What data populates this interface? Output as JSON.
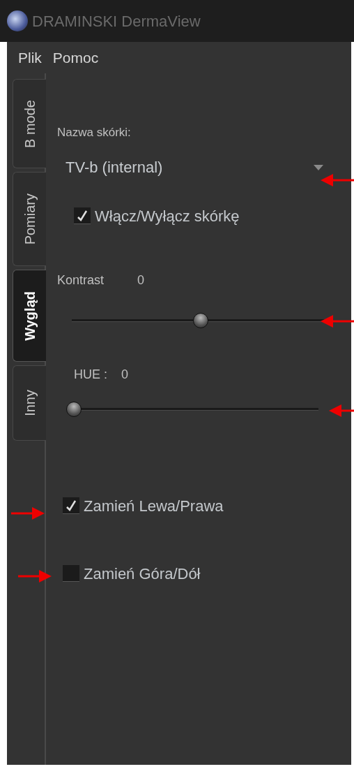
{
  "window": {
    "title": "DRAMINSKI DermaView"
  },
  "menu": [
    "Plik",
    "Pomoc"
  ],
  "tabs": [
    {
      "label": "B mode",
      "selected": false
    },
    {
      "label": "Pomiary",
      "selected": false
    },
    {
      "label": "Wygląd",
      "selected": true
    },
    {
      "label": "Inny",
      "selected": false
    }
  ],
  "skin": {
    "label": "Nazwa skórki:",
    "value": "TV-b (internal)",
    "toggle": {
      "label": "Włącz/Wyłącz skórkę",
      "checked": true
    }
  },
  "sliders": [
    {
      "label": "Kontrast",
      "reading": "0",
      "level": 0.5
    },
    {
      "label": "HUE :",
      "reading": "0",
      "level": 0
    }
  ],
  "options": [
    {
      "label": "Zamień Lewa/Prawa",
      "checked": true
    },
    {
      "label": "Zamień Góra/Dół",
      "checked": false
    }
  ]
}
